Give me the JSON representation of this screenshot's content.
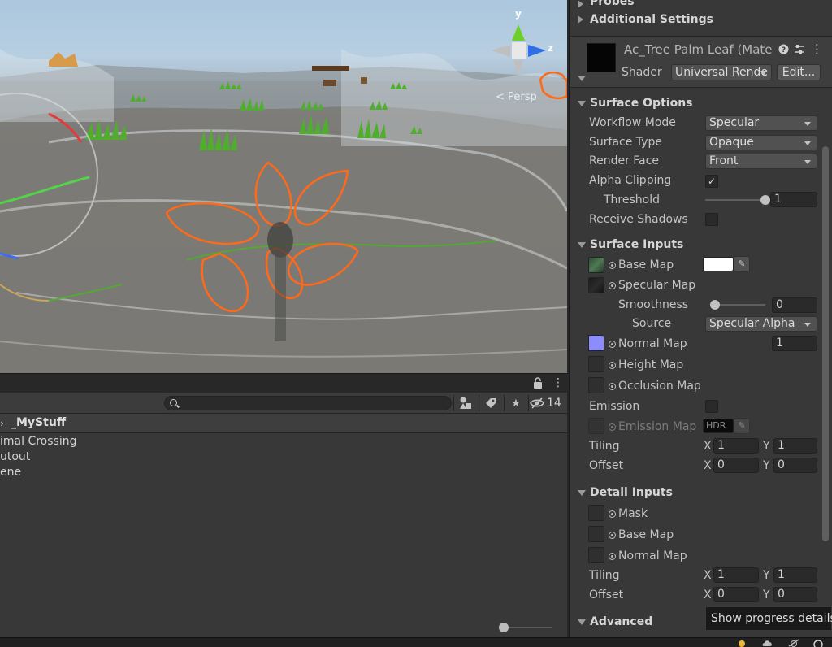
{
  "scene": {
    "gizmo": {
      "y_label": "y",
      "z_label": "z"
    },
    "camera_mode": "< Persp"
  },
  "panel": {
    "visibility_count": "14",
    "breadcrumb": "_MyStuff",
    "items": [
      "imal Crossing",
      "utout",
      "ene"
    ]
  },
  "inspector": {
    "top_items": [
      {
        "label": "Probes"
      },
      {
        "label": "Additional Settings"
      }
    ],
    "material": {
      "name": "Ac_Tree Palm Leaf (Mate",
      "shader_label": "Shader",
      "shader_value": "Universal Rende",
      "edit_label": "Edit..."
    },
    "surface_options": {
      "title": "Surface Options",
      "workflow_mode": {
        "label": "Workflow Mode",
        "value": "Specular"
      },
      "surface_type": {
        "label": "Surface Type",
        "value": "Opaque"
      },
      "render_face": {
        "label": "Render Face",
        "value": "Front"
      },
      "alpha_clipping": {
        "label": "Alpha Clipping",
        "checked": "✓"
      },
      "threshold": {
        "label": "Threshold",
        "value": "1",
        "level": 1.0
      },
      "receive_shadows": {
        "label": "Receive Shadows"
      }
    },
    "surface_inputs": {
      "title": "Surface Inputs",
      "base_map": "Base Map",
      "specular_map": "Specular Map",
      "smoothness": {
        "label": "Smoothness",
        "value": "0",
        "level": 0.0
      },
      "source": {
        "label": "Source",
        "value": "Specular Alpha"
      },
      "normal_map": {
        "label": "Normal Map",
        "value": "1"
      },
      "height_map": "Height Map",
      "occlusion_map": "Occlusion Map",
      "emission": "Emission",
      "emission_map": "Emission Map",
      "hdr_label": "HDR",
      "tiling": {
        "label": "Tiling",
        "x": "1",
        "y": "1"
      },
      "offset": {
        "label": "Offset",
        "x": "0",
        "y": "0"
      }
    },
    "detail_inputs": {
      "title": "Detail Inputs",
      "mask": "Mask",
      "base_map": "Base Map",
      "normal_map": "Normal Map",
      "tiling": {
        "label": "Tiling",
        "x": "1",
        "y": "1"
      },
      "offset": {
        "label": "Offset",
        "x": "0",
        "y": "0"
      }
    },
    "advanced": {
      "title": "Advanced"
    },
    "axis_x": "X",
    "axis_y": "Y"
  },
  "tooltip": "Show progress details",
  "colors": {
    "selection_outline": "#ff6a1a",
    "gizmo_y": "#6ccf2a",
    "gizmo_z": "#2e6fe8",
    "base_color": "#ffffff",
    "normal_thumb": "#8c8cff"
  }
}
